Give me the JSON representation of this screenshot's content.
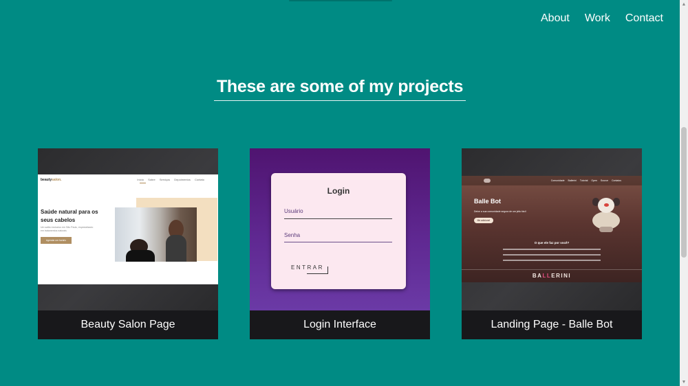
{
  "nav": {
    "items": [
      "About",
      "Work",
      "Contact"
    ]
  },
  "section": {
    "title": "These are some of my projects"
  },
  "projects": [
    {
      "caption": "Beauty Salon Page",
      "preview": {
        "logo_main": "beauty",
        "logo_accent": "salon.",
        "nav": "Início Sobre Serviços Depoimentos Contato",
        "headline": "Saúde natural para os seus cabelos",
        "subtext": "Um salão exclusivo em São Paulo, especializado em tratamentos naturais",
        "button": "Agendar um horário"
      }
    },
    {
      "caption": "Login Interface",
      "preview": {
        "title": "Login",
        "user_label": "Usuário",
        "password_label": "Senha",
        "button": "ENTRAR"
      }
    },
    {
      "caption": "Landing Page - Balle Bot",
      "preview": {
        "nav": "Comunidade Ballerini Tutorial Open Source Contatos",
        "title": "Balle Bot",
        "subtext": "Deixe a sua comunidade segura de um jeito fácil",
        "button": "Me adicione!",
        "question": "O que ele faz por você?",
        "brand_start": "BA",
        "brand_accent": "LL",
        "brand_end": "ERINI"
      }
    }
  ],
  "colors": {
    "background": "#008b84",
    "card_caption_bg": "#18181b",
    "salon_accent": "#b08f62",
    "login_purple": "#5f2891"
  }
}
